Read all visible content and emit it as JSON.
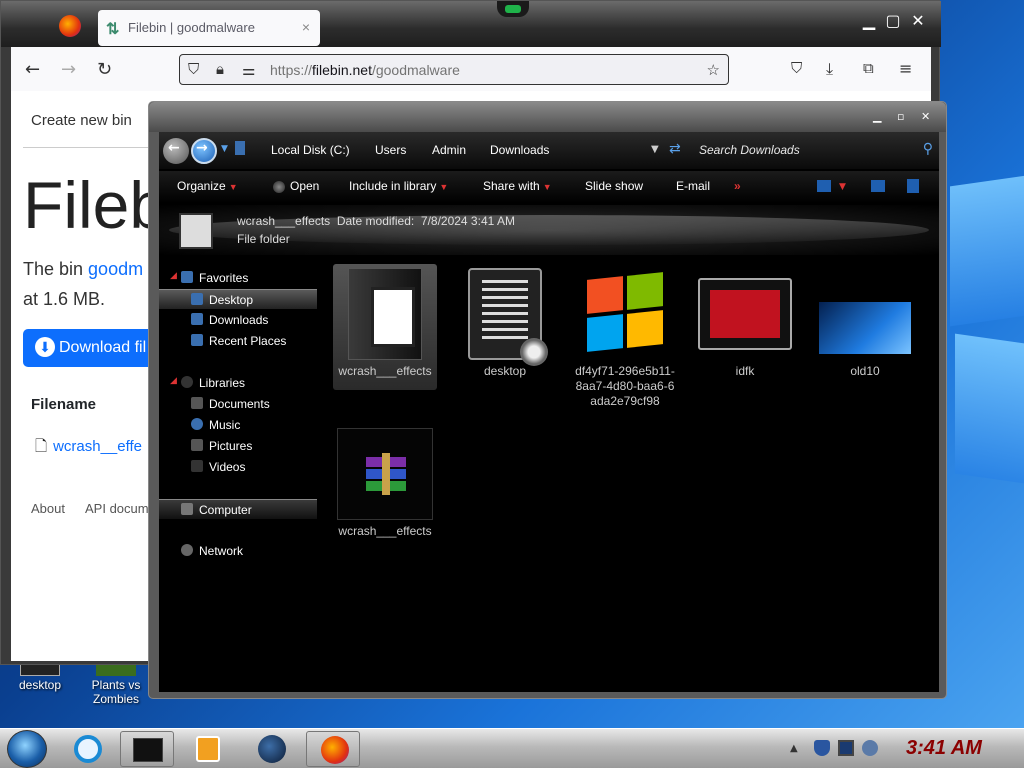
{
  "colors": {
    "accent_blue": "#0d6efd",
    "explorer_bg": "#000000",
    "clock_color": "#8b0000",
    "nav_arrow_red": "#dd3333"
  },
  "desktop": {
    "icons": [
      {
        "label": "desktop",
        "icon": "desktop-icon"
      },
      {
        "label": "Plants vs Zombies",
        "icon": "game-icon"
      }
    ]
  },
  "browser": {
    "tab_title": "Filebin | goodmalware",
    "tab_close": "×",
    "url_protocol": "https://",
    "url_host": "filebin.net",
    "url_path": "/goodmalware",
    "page": {
      "create_link": "Create new bin",
      "heading": "Fileb",
      "desc_prefix": "The bin ",
      "desc_link": "goodm",
      "desc_line2": "at 1.6 MB.",
      "download_button": "Download fil",
      "table_header": "Filename",
      "file_link": "wcrash__effe",
      "footer_about": "About",
      "footer_api": "API docum"
    }
  },
  "explorer": {
    "breadcrumbs": [
      "Local Disk (C:)",
      "Users",
      "Admin",
      "Downloads"
    ],
    "search_placeholder": "Search Downloads",
    "commands": {
      "organize": "Organize",
      "open": "Open",
      "include": "Include in library",
      "share": "Share with",
      "slideshow": "Slide show",
      "email": "E-mail",
      "more": "»"
    },
    "details": {
      "name": "wcrash___effects",
      "modified_label": "Date modified:",
      "modified_value": "7/8/2024 3:41 AM",
      "type": "File folder"
    },
    "nav": {
      "favorites": "Favorites",
      "desktop": "Desktop",
      "downloads": "Downloads",
      "recent": "Recent Places",
      "libraries": "Libraries",
      "documents": "Documents",
      "music": "Music",
      "pictures": "Pictures",
      "videos": "Videos",
      "computer": "Computer",
      "network": "Network"
    },
    "files": [
      {
        "name": "wcrash___effects",
        "icon": "folder-icon"
      },
      {
        "name": "desktop",
        "icon": "settings-file-icon"
      },
      {
        "name": "df4yf71-296e5b11-8aa7-4d80-baa6-6ada2e79cf98",
        "icon": "windows-logo-icon"
      },
      {
        "name": "idfk",
        "icon": "red-image-icon"
      },
      {
        "name": "old10",
        "icon": "windows10-wallpaper-icon"
      },
      {
        "name": "wcrash___effects",
        "icon": "winrar-archive-icon"
      }
    ]
  },
  "taskbar": {
    "clock": "3:41 AM"
  }
}
